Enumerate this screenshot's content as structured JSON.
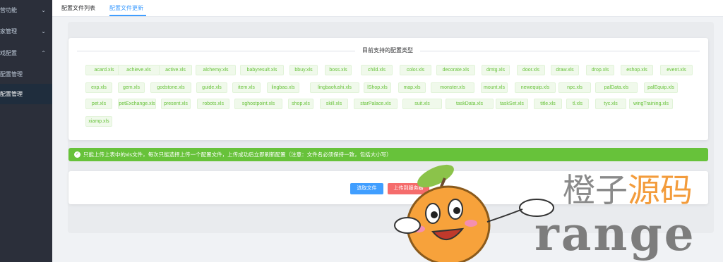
{
  "sidebar": {
    "items": [
      {
        "label": "营功能",
        "chevron": "⌄",
        "active": false
      },
      {
        "label": "家管理",
        "chevron": "⌄",
        "active": false
      },
      {
        "label": "戏配置",
        "chevron": "⌃",
        "active": false
      },
      {
        "label": "配置管理",
        "chevron": "",
        "active": false
      },
      {
        "label": "配置管理",
        "chevron": "",
        "active": true
      }
    ]
  },
  "tabs": [
    {
      "label": "配置文件列表",
      "active": false
    },
    {
      "label": "配置文件更新",
      "active": true
    }
  ],
  "types_section": {
    "title": "目前支持的配置类型",
    "tags": [
      "acard.xls",
      "achieve.xls",
      "active.xls",
      "alchemy.xls",
      "babyresult.xls",
      "bbuy.xls",
      "boss.xls",
      "child.xls",
      "color.xls",
      "decorate.xls",
      "dmtg.xls",
      "door.xls",
      "draw.xls",
      "drop.xls",
      "eshop.xls",
      "event.xls",
      "exp.xls",
      "gem.xls",
      "godstone.xls",
      "guide.xls",
      "item.xls",
      "lingbao.xls",
      "lingbaofushi.xls",
      "lShop.xls",
      "map.xls",
      "monster.xls",
      "mount.xls",
      "newequip.xls",
      "npc.xls",
      "palData.xls",
      "palEquip.xls",
      "pet.xls",
      "petExchange.xls",
      "present.xls",
      "robots.xls",
      "sghostpoint.xls",
      "shop.xls",
      "skill.xls",
      "starPalace.xls",
      "suit.xls",
      "taskData.xls",
      "taskSet.xls",
      "title.xls",
      "tl.xls",
      "tyc.xls",
      "wingTraining.xls",
      "xiamp.xls"
    ]
  },
  "alert": {
    "icon": "check-circle-icon",
    "text": "只能上传上表中的xls文件，每次只能选择上传一个配置文件，上传成功后立即刷新配置（注意：文件名必须保持一致，包括大小写）"
  },
  "upload": {
    "choose_label": "选取文件",
    "upload_label": "上传到服务器"
  },
  "watermark": {
    "cn_part1": "橙子",
    "cn_part2": "源码",
    "en": "range"
  },
  "colors": {
    "sidebar_bg": "#2b2f3a",
    "accent": "#409eff",
    "success": "#67c23a",
    "danger": "#f56c6c",
    "watermark_orange": "#f39c3c"
  }
}
